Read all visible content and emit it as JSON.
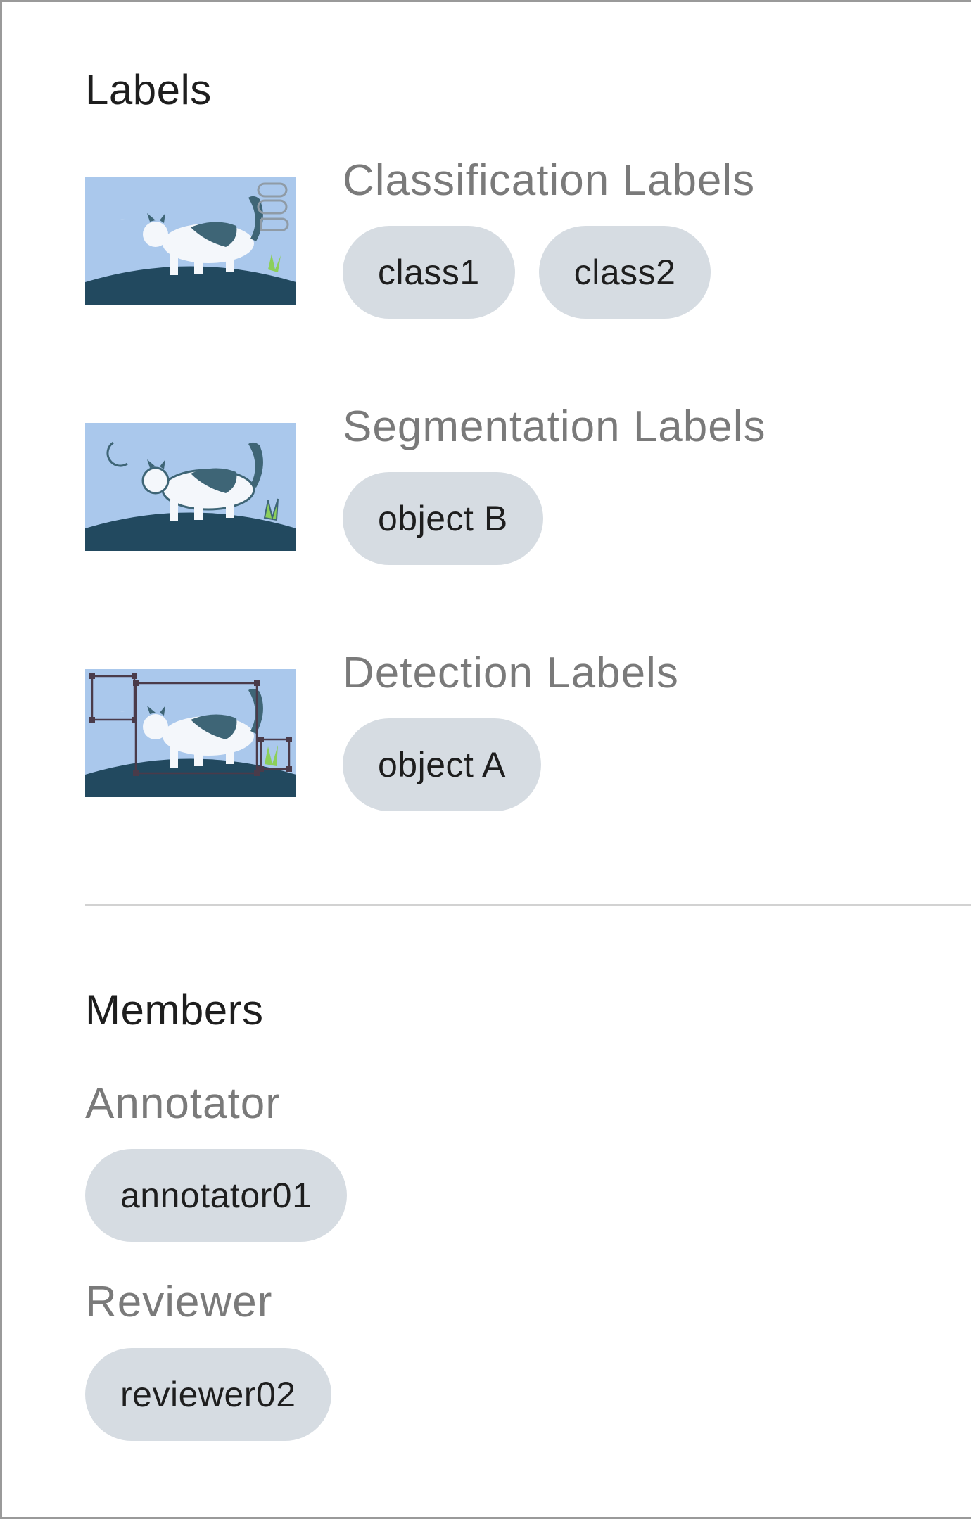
{
  "labels": {
    "title": "Labels",
    "groups": [
      {
        "title": "Classification Labels",
        "thumbnail_icon": "classification-thumbnail-icon",
        "chips": [
          "class1",
          "class2"
        ]
      },
      {
        "title": "Segmentation Labels",
        "thumbnail_icon": "segmentation-thumbnail-icon",
        "chips": [
          "object B"
        ]
      },
      {
        "title": "Detection Labels",
        "thumbnail_icon": "detection-thumbnail-icon",
        "chips": [
          "object A"
        ]
      }
    ]
  },
  "members": {
    "title": "Members",
    "roles": [
      {
        "title": "Annotator",
        "users": [
          "annotator01"
        ]
      },
      {
        "title": "Reviewer",
        "users": [
          "reviewer02"
        ]
      }
    ]
  },
  "colors": {
    "chip_bg": "#d6dce2",
    "sky": "#aac8ec",
    "ground": "#22495f",
    "cat_body": "#f4f7fb",
    "cat_dark": "#3e6576",
    "grass": "#8ccf5a"
  }
}
